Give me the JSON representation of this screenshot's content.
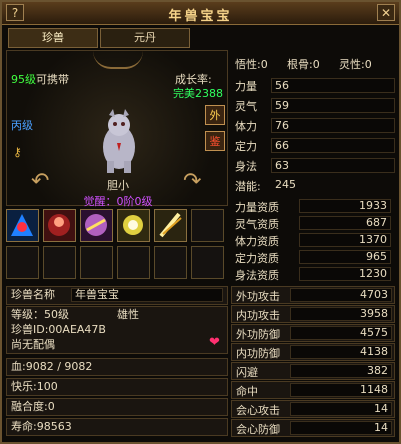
{
  "window": {
    "title": "年兽宝宝"
  },
  "tabs": [
    {
      "label": "珍兽"
    },
    {
      "label": "元丹"
    }
  ],
  "pet": {
    "level_text": "95级",
    "carry_text": "可携带",
    "growth_label": "成长率:",
    "growth_value": "完美2388",
    "grade": "丙级",
    "name": "胆小",
    "awaken": "觉醒：0阶0级",
    "outer_button": "外",
    "appraise_button": "鉴"
  },
  "skills": {
    "filled": 5,
    "total": 12
  },
  "info": {
    "name_label": "珍兽名称",
    "name_value": "年兽宝宝",
    "level": "等级：50级",
    "gender": "雄性",
    "id": "珍兽ID:00AEA47B",
    "spouse": "尚无配偶",
    "hp": "血:9082 / 9082",
    "happy": "快乐:100",
    "fusion": "融合度:0",
    "life": "寿命:98563"
  },
  "traits": {
    "wuxing": "悟性:0",
    "genbone": "根骨:0",
    "lingxing": "灵性:0"
  },
  "attrs": [
    {
      "label": "力量",
      "value": "56"
    },
    {
      "label": "灵气",
      "value": "59"
    },
    {
      "label": "体力",
      "value": "76"
    },
    {
      "label": "定力",
      "value": "66"
    },
    {
      "label": "身法",
      "value": "63"
    }
  ],
  "potential": {
    "label": "潜能:",
    "value": "245"
  },
  "aptitudes": [
    {
      "label": "力量资质",
      "value": "1933"
    },
    {
      "label": "灵气资质",
      "value": "687"
    },
    {
      "label": "体力资质",
      "value": "1370"
    },
    {
      "label": "定力资质",
      "value": "965"
    },
    {
      "label": "身法资质",
      "value": "1230"
    }
  ],
  "combat": [
    {
      "label": "外功攻击",
      "value": "4703"
    },
    {
      "label": "内功攻击",
      "value": "3958"
    },
    {
      "label": "外功防御",
      "value": "4575"
    },
    {
      "label": "内功防御",
      "value": "4138"
    },
    {
      "label": "闪避",
      "value": "382"
    },
    {
      "label": "命中",
      "value": "1148"
    },
    {
      "label": "会心攻击",
      "value": "14"
    },
    {
      "label": "会心防御",
      "value": "14"
    }
  ],
  "colors": {
    "accent": "#f5d38a",
    "growth": "#30ff60",
    "grade": "#4aa0ff",
    "awaken": "#d050ff"
  }
}
